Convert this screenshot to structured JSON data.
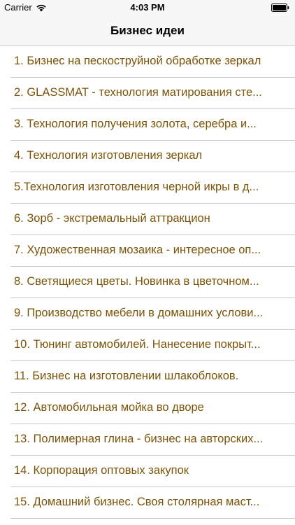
{
  "status_bar": {
    "carrier": "Carrier",
    "time": "4:03 PM",
    "icons": [
      "wifi-icon",
      "battery-icon"
    ]
  },
  "nav": {
    "title": "Бизнес идеи"
  },
  "colors": {
    "item_text": "#7a5408",
    "separator": "#c8c7cc",
    "bar_background": "#f7f7f7"
  },
  "items": [
    "1. Бизнес на пескоструйной обработке зеркал",
    "2. GLASSMAT - технология матирования сте...",
    "3. Технология получения золота, серебра и...",
    "4. Технология изготовления зеркал",
    "5.Технология изготовления черной икры в д...",
    "6. Зорб - экстремальный аттракцион",
    "7. Художественная мозаика - интересное оп...",
    "8. Светящиеся цветы. Новинка в цветочном...",
    "9. Производство мебели в домашних услови...",
    "10. Тюнинг автомобилей. Нанесение покрыт...",
    "11. Бизнес на изготовлении шлакоблоков.",
    "12. Автомобильная мойка во дворе",
    "13. Полимерная глина - бизнес на авторских...",
    "14. Корпорация оптовых закупок",
    "15. Домашний бизнес. Своя столярная маст..."
  ]
}
